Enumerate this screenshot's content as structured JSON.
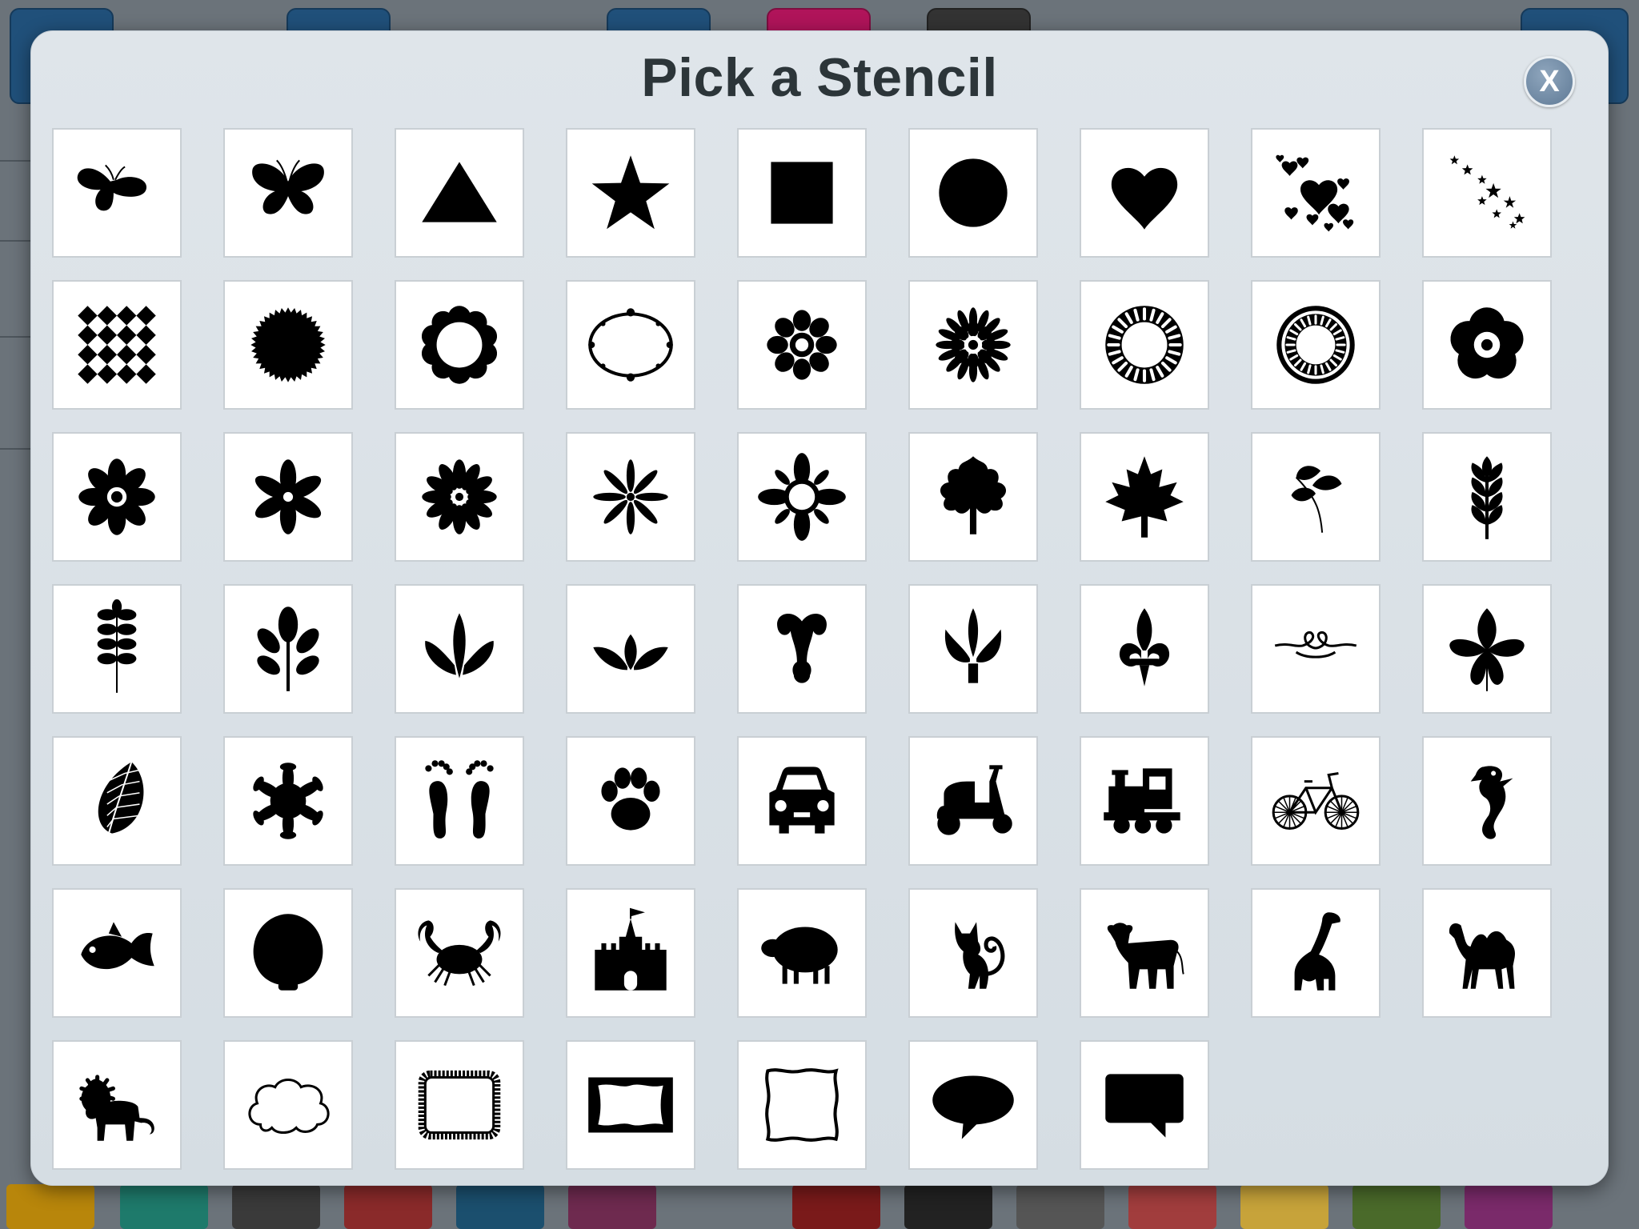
{
  "dialog": {
    "title": "Pick a Stencil",
    "close_label": "X"
  },
  "stencils": [
    "butterfly-side",
    "butterfly",
    "triangle",
    "star",
    "square",
    "circle",
    "heart",
    "hearts-scatter",
    "stars-scatter",
    "diamond-pattern",
    "sunburst-seal",
    "scalloped-circle",
    "ornate-oval-frame",
    "flower-petals",
    "daisy-starburst",
    "ring-of-petals",
    "mandala-ring",
    "pansy-flower",
    "daisy",
    "six-petal-flower",
    "chrysanthemum",
    "eight-petal-star-flower",
    "snowflake-medallion",
    "oak-leaf",
    "maple-leaf",
    "three-leaf-sprig",
    "wheat-sprig",
    "fern-sprig",
    "five-leaf-branch",
    "fleur-sprout",
    "tulip-swoosh",
    "ornamental-finial",
    "lotus-ornament",
    "fleur-de-lis",
    "scroll-flourish",
    "chestnut-leaf",
    "veined-leaf",
    "snowflake",
    "footprints",
    "paw-print",
    "car",
    "scooter",
    "train",
    "bicycle",
    "seahorse",
    "fish",
    "seashell",
    "crab",
    "castle",
    "sheep",
    "cat",
    "cow",
    "giraffe",
    "camel",
    "lion",
    "cloud-frame",
    "scalloped-rectangle-frame",
    "wavy-rectangle-frame",
    "wavy-square-frame",
    "speech-bubble-oval",
    "speech-bubble-rect"
  ]
}
